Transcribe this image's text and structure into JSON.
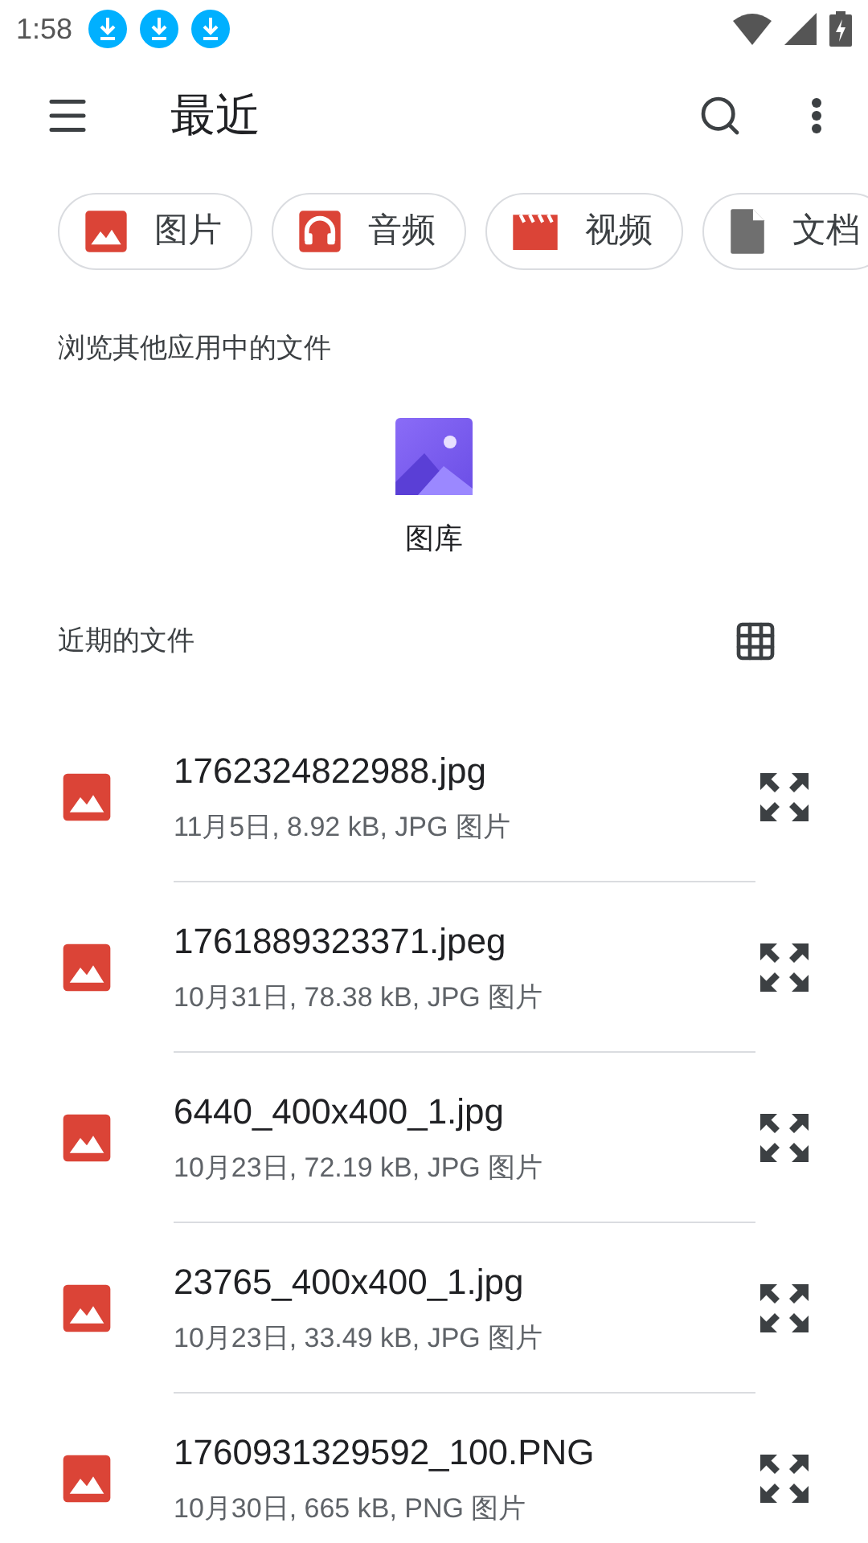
{
  "status_bar": {
    "time": "1:58",
    "notifications": [
      {
        "kind": "download"
      },
      {
        "kind": "download"
      },
      {
        "kind": "download"
      }
    ]
  },
  "app_bar": {
    "title": "最近"
  },
  "chips": [
    {
      "kind": "image",
      "label": "图片"
    },
    {
      "kind": "audio",
      "label": "音频"
    },
    {
      "kind": "video",
      "label": "视频"
    },
    {
      "kind": "document",
      "label": "文档"
    }
  ],
  "browse_section": {
    "heading": "浏览其他应用中的文件",
    "apps": [
      {
        "label": "图库"
      }
    ]
  },
  "recent_section": {
    "heading": "近期的文件"
  },
  "files": [
    {
      "name": "1762324822988.jpg",
      "meta": "11月5日, 8.92 kB, JPG 图片"
    },
    {
      "name": "1761889323371.jpeg",
      "meta": "10月31日, 78.38 kB, JPG 图片"
    },
    {
      "name": "6440_400x400_1.jpg",
      "meta": "10月23日, 72.19 kB, JPG 图片"
    },
    {
      "name": "23765_400x400_1.jpg",
      "meta": "10月23日, 33.49 kB, JPG 图片"
    },
    {
      "name": "1760931329592_100.PNG",
      "meta": "10月30日, 665 kB, PNG 图片"
    }
  ]
}
